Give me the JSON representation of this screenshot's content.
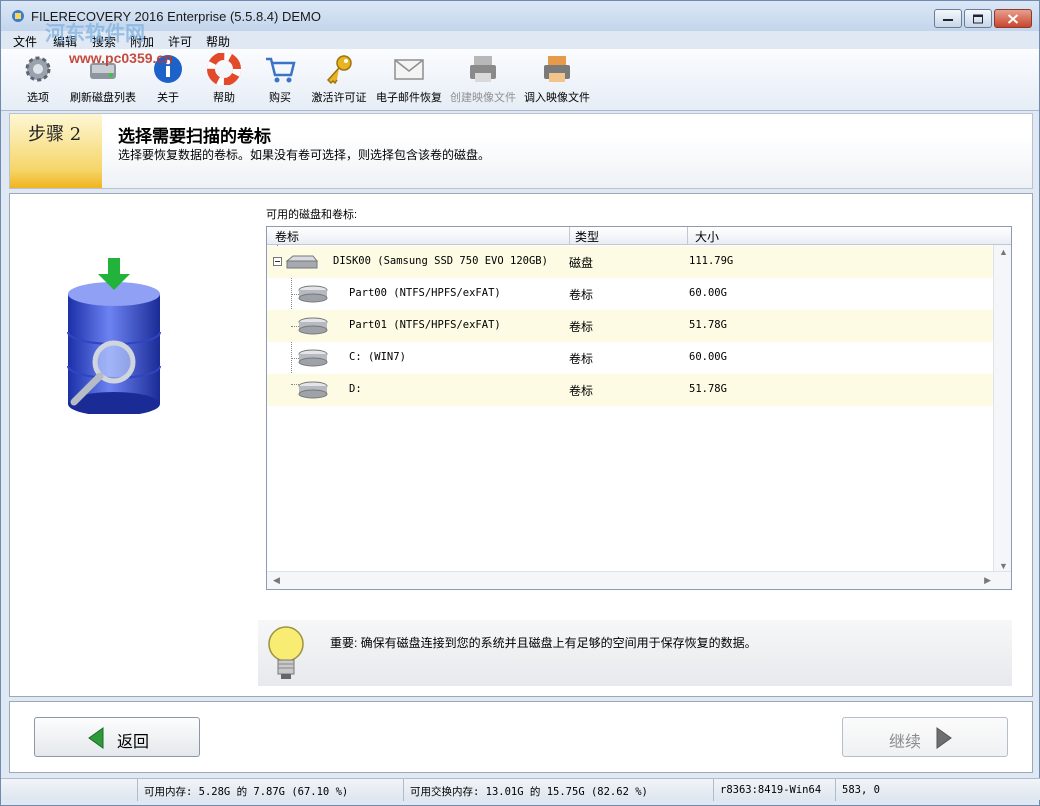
{
  "window": {
    "title": "FILERECOVERY 2016 Enterprise (5.5.8.4) DEMO"
  },
  "watermark": {
    "line1": "河东软件网",
    "line2": "www.pc0359.cn"
  },
  "menu": [
    "文件",
    "编辑",
    "搜索",
    "附加",
    "许可",
    "帮助"
  ],
  "toolbar": {
    "options": "选项",
    "refresh": "刷新磁盘列表",
    "about": "关于",
    "help": "帮助",
    "buy": "购买",
    "activate": "激活许可证",
    "email": "电子邮件恢复",
    "create_image": "创建映像文件",
    "load_image": "调入映像文件"
  },
  "step": {
    "tag": "步骤 2",
    "title": "选择需要扫描的卷标",
    "desc": "选择要恢复数据的卷标。如果没有卷可选择，则选择包含该卷的磁盘。"
  },
  "main": {
    "list_label": "可用的磁盘和卷标:",
    "columns": {
      "volume": "卷标",
      "type": "类型",
      "size": "大小"
    },
    "rows": [
      {
        "name": "DISK00 (Samsung SSD 750 EVO 120GB)",
        "type": "磁盘",
        "size": "111.79G"
      },
      {
        "name": "Part00 (NTFS/HPFS/exFAT)",
        "type": "卷标",
        "size": "60.00G"
      },
      {
        "name": "Part01 (NTFS/HPFS/exFAT)",
        "type": "卷标",
        "size": "51.78G"
      },
      {
        "name": "C: (WIN7)",
        "type": "卷标",
        "size": "60.00G"
      },
      {
        "name": "D:",
        "type": "卷标",
        "size": "51.78G"
      }
    ],
    "notice": "重要: 确保有磁盘连接到您的系统并且磁盘上有足够的空间用于保存恢复的数据。"
  },
  "nav": {
    "back": "返回",
    "next": "继续"
  },
  "status": {
    "mem": "可用内存: 5.28G 的 7.87G (67.10 %)",
    "swap": "可用交换内存: 13.01G 的 15.75G (82.62 %)",
    "build": "r8363:8419-Win64",
    "coords": "583, 0"
  },
  "colors": {
    "accent": "#f0b41e",
    "row_alt": "#fdfbe3",
    "back_arrow": "#2e9b3a"
  }
}
